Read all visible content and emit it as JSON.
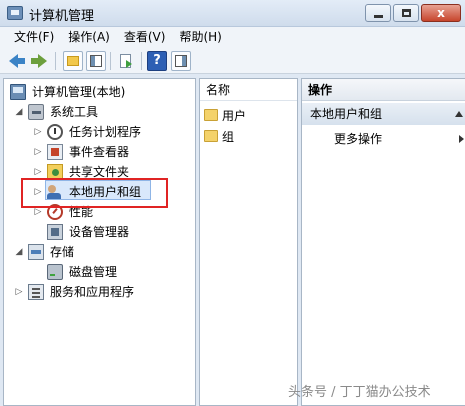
{
  "window": {
    "title": "计算机管理"
  },
  "menu": [
    "文件(F)",
    "操作(A)",
    "查看(V)",
    "帮助(H)"
  ],
  "tree": [
    {
      "label": "计算机管理(本地)",
      "expander": ""
    },
    {
      "label": "系统工具",
      "expander": "◢"
    },
    {
      "label": "任务计划程序",
      "expander": "▷"
    },
    {
      "label": "事件查看器",
      "expander": "▷"
    },
    {
      "label": "共享文件夹",
      "expander": "▷"
    },
    {
      "label": "本地用户和组",
      "expander": "▷"
    },
    {
      "label": "性能",
      "expander": "▷"
    },
    {
      "label": "设备管理器",
      "expander": ""
    },
    {
      "label": "存储",
      "expander": "◢"
    },
    {
      "label": "磁盘管理",
      "expander": ""
    },
    {
      "label": "服务和应用程序",
      "expander": "▷"
    }
  ],
  "list": {
    "header": "名称",
    "items": [
      "用户",
      "组"
    ]
  },
  "actions": {
    "header": "操作",
    "section": "本地用户和组",
    "more": "更多操作"
  },
  "toolbar": {
    "help_glyph": "?"
  },
  "window_buttons": {
    "close_glyph": "x"
  },
  "watermark": "头条号 / 丁丁猫办公技术"
}
